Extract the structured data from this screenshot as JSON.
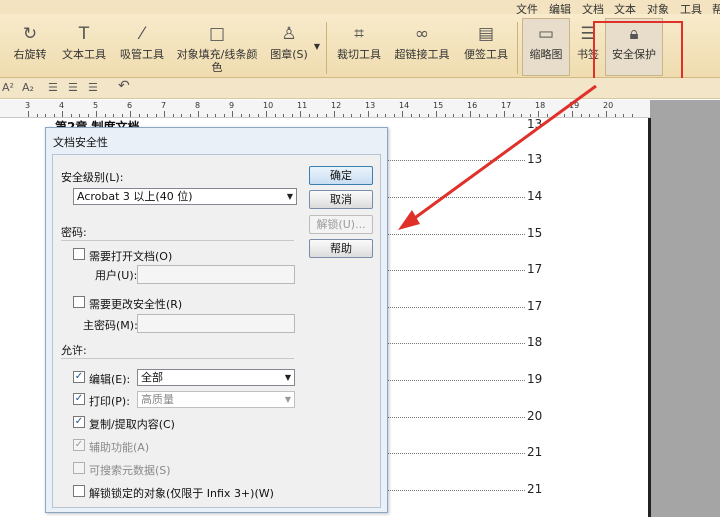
{
  "menu": [
    "文件",
    "编辑",
    "文档",
    "文本",
    "对象",
    "工具",
    "帮"
  ],
  "ribbon": {
    "tools": [
      {
        "label": "右旋转",
        "icon": "rotate-icon"
      },
      {
        "label": "文本工具",
        "icon": "text-tool-icon"
      },
      {
        "label": "吸管工具",
        "icon": "eyedropper-icon"
      },
      {
        "label": "对象填充/线条颜",
        "label2": "色",
        "icon": "fill-color-icon"
      },
      {
        "label": "图章(S)",
        "icon": "stamp-icon"
      },
      {
        "label": "裁切工具",
        "icon": "crop-icon"
      },
      {
        "label": "超链接工具",
        "icon": "hyperlink-icon"
      },
      {
        "label": "便签工具",
        "icon": "note-icon"
      },
      {
        "label": "缩略图",
        "icon": "thumbnail-icon"
      },
      {
        "label": "书签",
        "icon": "bookmark-icon"
      },
      {
        "label": "安全保护",
        "icon": "lock-icon"
      }
    ]
  },
  "format": {
    "superscript": "A²",
    "subscript": "A₂"
  },
  "ruler": {
    "labels": [
      "3",
      "4",
      "5",
      "6",
      "7",
      "8",
      "9",
      "10",
      "11",
      "12",
      "13",
      "14",
      "15",
      "16",
      "17",
      "18",
      "19",
      "20"
    ]
  },
  "document": {
    "heading": "第2章 制度文档",
    "toc_pages": [
      "13",
      "13",
      "14",
      "15",
      "17",
      "17",
      "18",
      "19",
      "20",
      "21",
      "21"
    ]
  },
  "dialog": {
    "title": "文档安全性",
    "security_level_label": "安全级别(L):",
    "security_level_value": "Acrobat 3 以上(40 位)",
    "ok": "确定",
    "cancel": "取消",
    "unlock": "解锁(U)...",
    "help": "帮助",
    "password_section": "密码:",
    "require_open": "需要打开文档(O)",
    "user_label": "用户(U):",
    "require_change": "需要更改安全性(R)",
    "master_label": "主密码(M):",
    "permit_section": "允许:",
    "edit_label": "编辑(E):",
    "edit_value": "全部",
    "print_label": "打印(P):",
    "print_value": "高质量",
    "copy_label": "复制/提取内容(C)",
    "accessibility_label": "辅助功能(A)",
    "searchable_label": "可搜索元数据(S)",
    "unlock_objects_label": "解锁锁定的对象(仅限于 Infix 3+)(W)"
  },
  "colors": {
    "highlight": "#e0302a",
    "ribbon": "#f3e3c0"
  }
}
